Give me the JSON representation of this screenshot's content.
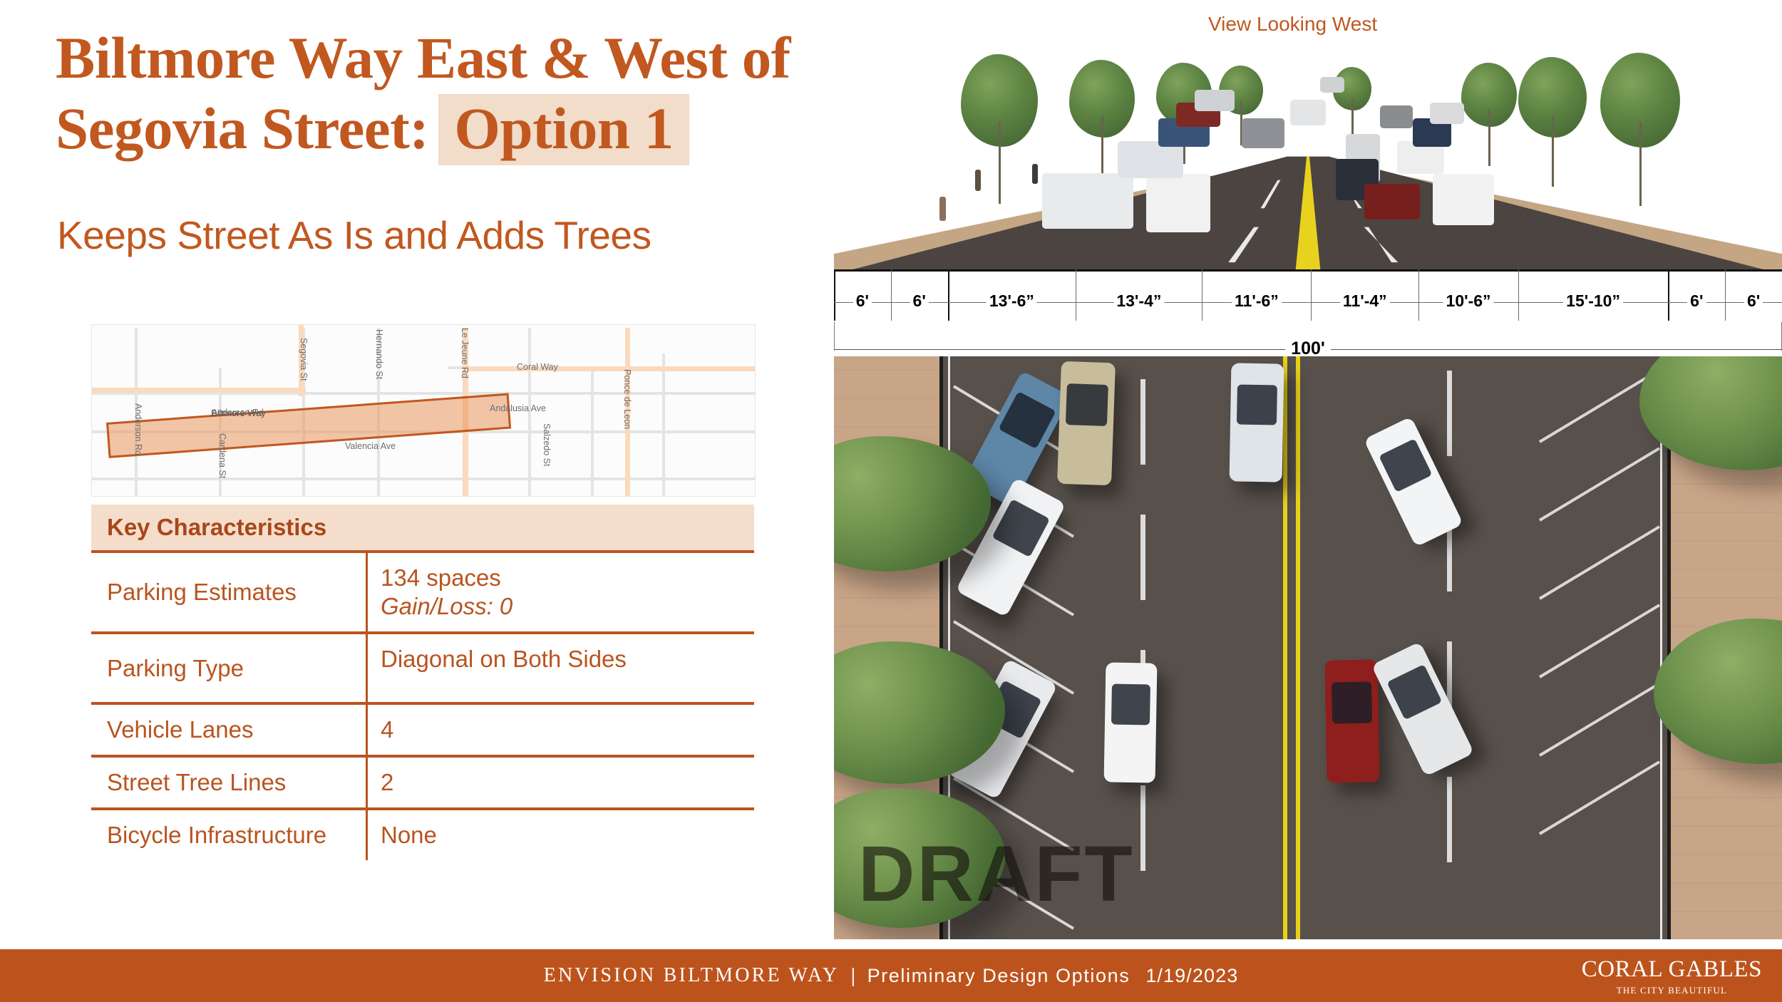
{
  "slide": {
    "title_line1": "Biltmore Way East & West of",
    "title_line2_prefix": "Segovia Street:",
    "title_option": "Option 1",
    "subtitle": "Keeps Street As Is and Adds Trees",
    "draft_watermark": "DRAFT"
  },
  "perspective": {
    "view_label": "View Looking West"
  },
  "map": {
    "corridor_label": "Biltmore Way",
    "streets": [
      {
        "name": "Anderson Rd",
        "orientation": "vertical"
      },
      {
        "name": "Cardena St",
        "orientation": "vertical"
      },
      {
        "name": "Segovia St",
        "orientation": "vertical"
      },
      {
        "name": "Hernando St",
        "orientation": "vertical"
      },
      {
        "name": "Le Jeune Rd",
        "orientation": "vertical"
      },
      {
        "name": "Salzedo St",
        "orientation": "vertical"
      },
      {
        "name": "Ponce de Leon",
        "orientation": "vertical"
      },
      {
        "name": "Coral Way",
        "orientation": "horizontal"
      },
      {
        "name": "Andalusia Ave",
        "orientation": "horizontal"
      },
      {
        "name": "Valencia Ave",
        "orientation": "horizontal"
      }
    ]
  },
  "key_characteristics": {
    "header": "Key Characteristics",
    "rows": [
      {
        "key": "Parking Estimates",
        "value": "134 spaces",
        "sub": "Gain/Loss: 0"
      },
      {
        "key": "Parking Type",
        "value": "Diagonal on Both Sides",
        "sub": ""
      },
      {
        "key": "Vehicle Lanes",
        "value": "4",
        "sub": ""
      },
      {
        "key": "Street Tree Lines",
        "value": "2",
        "sub": ""
      },
      {
        "key": "Bicycle Infrastructure",
        "value": "None",
        "sub": ""
      }
    ]
  },
  "cross_section": {
    "total_label": "100'",
    "total_feet": 100,
    "segments": [
      {
        "label": "6'",
        "feet": 6
      },
      {
        "label": "6'",
        "feet": 6
      },
      {
        "label": "13'-6”",
        "feet": 13.5
      },
      {
        "label": "13'-4”",
        "feet": 13.333
      },
      {
        "label": "11'-6”",
        "feet": 11.5
      },
      {
        "label": "11'-4”",
        "feet": 11.333
      },
      {
        "label": "10'-6”",
        "feet": 10.5
      },
      {
        "label": "15'-10”",
        "feet": 15.833
      },
      {
        "label": "6'",
        "feet": 6
      },
      {
        "label": "6'",
        "feet": 6
      }
    ]
  },
  "footer": {
    "project": "ENVISION BILTMORE WAY",
    "separator": "|",
    "phase": "Preliminary Design Options",
    "date": "1/19/2023",
    "logo_main": "CORAL GABLES",
    "logo_sub": "THE CITY BEAUTIFUL"
  },
  "colors": {
    "brand_rust": "#BD531C",
    "title_orange": "#C1581F",
    "highlight_peach": "#F2DCCA",
    "table_header_bg": "#F4DECB",
    "table_rule": "#B9541F",
    "asphalt": "#57504B",
    "sidewalk": "#C9A588",
    "centerline_yellow": "#E9D018"
  }
}
